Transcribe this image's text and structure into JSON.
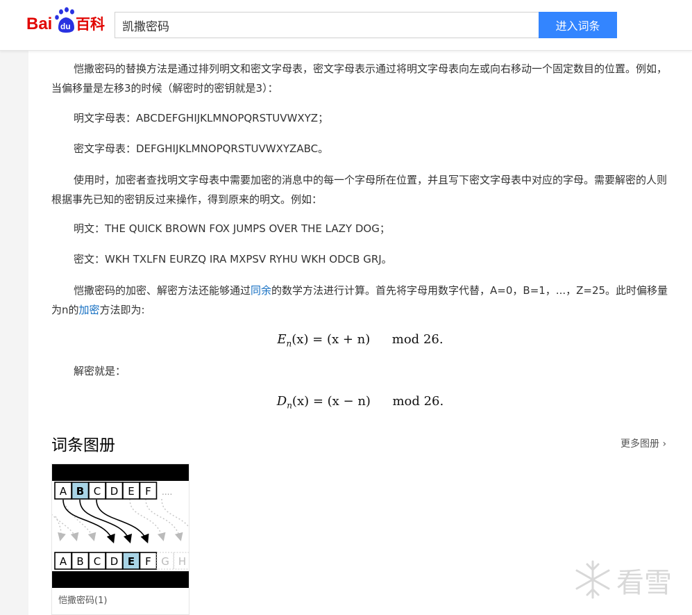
{
  "header": {
    "logo_text_bai": "Bai",
    "logo_text_du": "du",
    "logo_text_baike": "百科",
    "search_value": "凯撒密码",
    "search_button": "进入词条"
  },
  "article": {
    "p1": "恺撒密码的替换方法是通过排列明文和密文字母表，密文字母表示通过将明文字母表向左或向右移动一个固定数目的位置。例如，当偏移量是左移3的时候（解密时的密钥就是3）：",
    "p2": "明文字母表：ABCDEFGHIJKLMNOPQRSTUVWXYZ；",
    "p3": "密文字母表：DEFGHIJKLMNOPQRSTUVWXYZABC。",
    "p4": "使用时，加密者查找明文字母表中需要加密的消息中的每一个字母所在位置，并且写下密文字母表中对应的字母。需要解密的人则根据事先已知的密钥反过来操作，得到原来的明文。例如：",
    "p5": "明文：THE QUICK BROWN FOX JUMPS OVER THE LAZY DOG；",
    "p6": "密文：WKH TXLFN EURZQ IRA MXPSV RYHU WKH ODCB GRJ。",
    "p7_pre": "恺撒密码的加密、解密方法还能够通过",
    "p7_link": "同余",
    "p7_mid": "的数学方法进行计算。首先将字母用数字代替，A=0，B=1，...，Z=25。此时偏移量为n的",
    "p7_link2": "加密",
    "p7_post": "方法即为:",
    "formula_enc_lhs": "E",
    "formula_enc_sub": "n",
    "formula_enc_rhs": "(x) = (x + n)",
    "formula_mod": "mod",
    "formula_26": "26.",
    "p8": "解密就是：",
    "formula_dec_lhs": "D",
    "formula_dec_sub": "n",
    "formula_dec_rhs": "(x) = (x − n)"
  },
  "album": {
    "section_title": "词条图册",
    "more_label": "更多图册",
    "card_caption": "恺撒密码",
    "card_count": "(1)",
    "top_letters": [
      "A",
      "B",
      "C",
      "D",
      "E",
      "F"
    ],
    "top_ellipsis": "....",
    "bottom_letters": [
      "A",
      "B",
      "C",
      "D",
      "E",
      "F",
      "G",
      "H"
    ]
  },
  "watermark": {
    "text": "看雪"
  },
  "colors": {
    "accent": "#3385ff",
    "link": "#136ec2",
    "logo_red": "#e10602",
    "logo_blue": "#2932e1",
    "highlight": "#a8d4e6"
  }
}
